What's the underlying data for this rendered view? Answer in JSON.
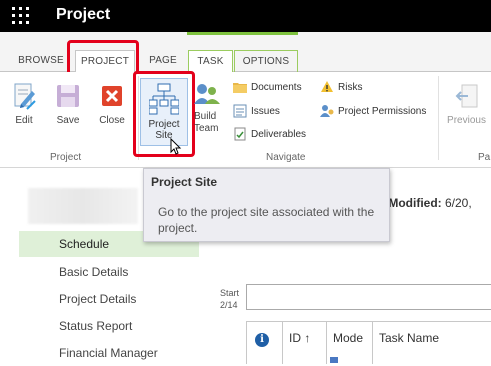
{
  "app": {
    "title": "Project"
  },
  "tabs": [
    "BROWSE",
    "PROJECT",
    "PAGE",
    "TASK",
    "OPTIONS"
  ],
  "ribbon": {
    "project_group": {
      "label": "Project",
      "buttons": [
        "Edit",
        "Save",
        "Close"
      ]
    },
    "navigate_group": {
      "label": "Navigate",
      "project_site": [
        "Project",
        "Site"
      ],
      "build_team": [
        "Build",
        "Team"
      ],
      "small_buttons": [
        "Documents",
        "Issues",
        "Deliverables",
        "Risks",
        "Project Permissions"
      ]
    },
    "previous": "Previous",
    "page_group_partial": "Pa"
  },
  "tooltip": {
    "title": "Project Site",
    "body": "Go to the project site associated with the project."
  },
  "last_modified": {
    "label": "t Modified:",
    "value": "6/20,"
  },
  "left_nav": [
    "Schedule",
    "Basic Details",
    "Project Details",
    "Status Report",
    "Financial Manager"
  ],
  "timeline": {
    "start_label": "Start",
    "start_date": "2/14"
  },
  "grid_headers": {
    "info": "i",
    "id": "ID ↑",
    "mode": "Mode",
    "task_name": "Task Name"
  },
  "colors": {
    "accent_green": "#7ec23e",
    "highlight_red": "#e3001b",
    "selected_nav": "#dff0d8"
  }
}
